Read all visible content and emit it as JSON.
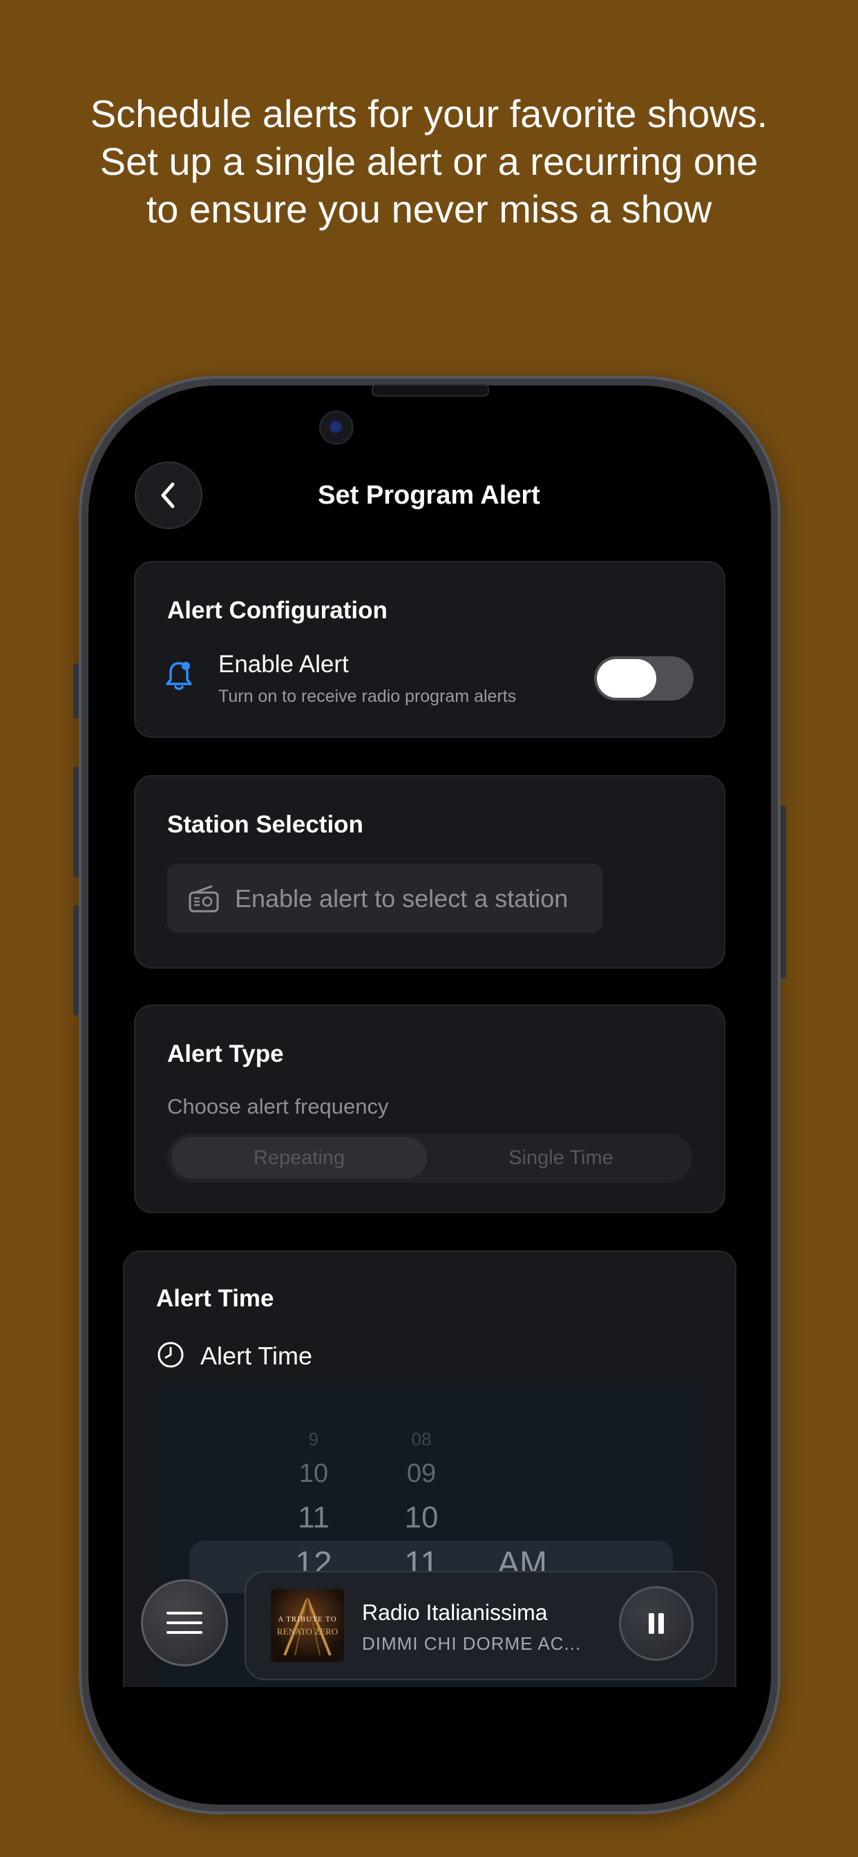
{
  "caption": {
    "line1": "Schedule alerts for your favorite shows.",
    "line2": "Set up a single alert or a recurring one",
    "line3": "to ensure you never miss a show"
  },
  "header": {
    "title": "Set Program Alert"
  },
  "alert_configuration": {
    "title": "Alert Configuration",
    "enable_label": "Enable Alert",
    "enable_sub": "Turn on to receive radio program alerts",
    "enabled": false
  },
  "station_selection": {
    "title": "Station Selection",
    "placeholder": "Enable alert to select a station"
  },
  "alert_type": {
    "title": "Alert Type",
    "subtitle": "Choose alert frequency",
    "options": [
      "Repeating",
      "Single Time"
    ],
    "selected": "Repeating"
  },
  "alert_time": {
    "title": "Alert Time",
    "label": "Alert Time",
    "hours": [
      "9",
      "10",
      "11",
      "12"
    ],
    "minutes": [
      "08",
      "09",
      "10",
      "11"
    ],
    "period": "AM"
  },
  "player": {
    "station": "Radio Italianissima",
    "track": "DIMMI CHI DORME AC...",
    "artwork_line1": "A TRIBUTE TO",
    "artwork_line2": "RENATO ZERO"
  },
  "icons": {
    "back": "chevron-left-icon",
    "bell": "bell-icon",
    "radio": "radio-icon",
    "clock": "clock-icon",
    "menu": "hamburger-menu-icon",
    "pause": "pause-icon"
  },
  "colors": {
    "background": "#744c12",
    "accent_blue": "#2f8cff",
    "screen": "#000000",
    "card": "#18191c"
  }
}
